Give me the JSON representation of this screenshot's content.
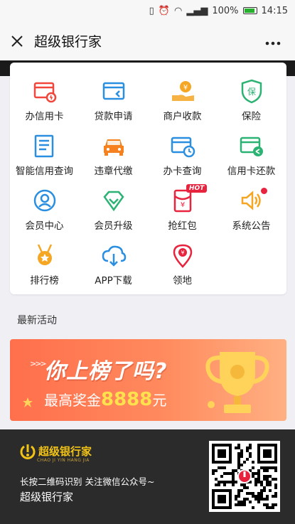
{
  "status_bar": {
    "battery": "100%",
    "time": "14:15"
  },
  "header": {
    "title": "超级银行家",
    "close_icon": "close-icon",
    "more_icon": "more-icon"
  },
  "menu": [
    {
      "label": "办信用卡",
      "icon": "credit-card-icon",
      "color": "#f0463c"
    },
    {
      "label": "贷款申请",
      "icon": "loan-card-icon",
      "color": "#2a8fe0"
    },
    {
      "label": "商户收款",
      "icon": "hand-coin-icon",
      "color": "#f5a623"
    },
    {
      "label": "保险",
      "icon": "shield-icon",
      "color": "#2cb374"
    },
    {
      "label": "智能信用查询",
      "icon": "document-icon",
      "color": "#2a8fe0"
    },
    {
      "label": "违章代缴",
      "icon": "car-icon",
      "color": "#f5821f"
    },
    {
      "label": "办卡查询",
      "icon": "card-clock-icon",
      "color": "#2a8fe0"
    },
    {
      "label": "信用卡还款",
      "icon": "card-refresh-icon",
      "color": "#2cb374"
    },
    {
      "label": "会员中心",
      "icon": "member-icon",
      "color": "#2a8fe0"
    },
    {
      "label": "会员升级",
      "icon": "diamond-icon",
      "color": "#2cb374"
    },
    {
      "label": "抢红包",
      "icon": "red-packet-icon",
      "color": "#e8233e",
      "badge": "HOT"
    },
    {
      "label": "系统公告",
      "icon": "speaker-icon",
      "color": "#f5a623",
      "dot": true
    },
    {
      "label": "排行榜",
      "icon": "medal-icon",
      "color": "#f5a623"
    },
    {
      "label": "APP下载",
      "icon": "cloud-download-icon",
      "color": "#2a8fe0"
    },
    {
      "label": "领地",
      "icon": "location-pin-icon",
      "color": "#e8233e"
    }
  ],
  "section": {
    "title": "最新活动"
  },
  "banner": {
    "headline": "你上榜了吗?",
    "subtitle_prefix": "最高奖金",
    "amount": "8888",
    "subtitle_suffix": "元"
  },
  "footer": {
    "logo_text": "超级银行家",
    "logo_sub": "CHAO JI YIN HANG JIA",
    "line1": "长按二维码识别 关注微信公众号~",
    "line2": "超级银行家"
  }
}
